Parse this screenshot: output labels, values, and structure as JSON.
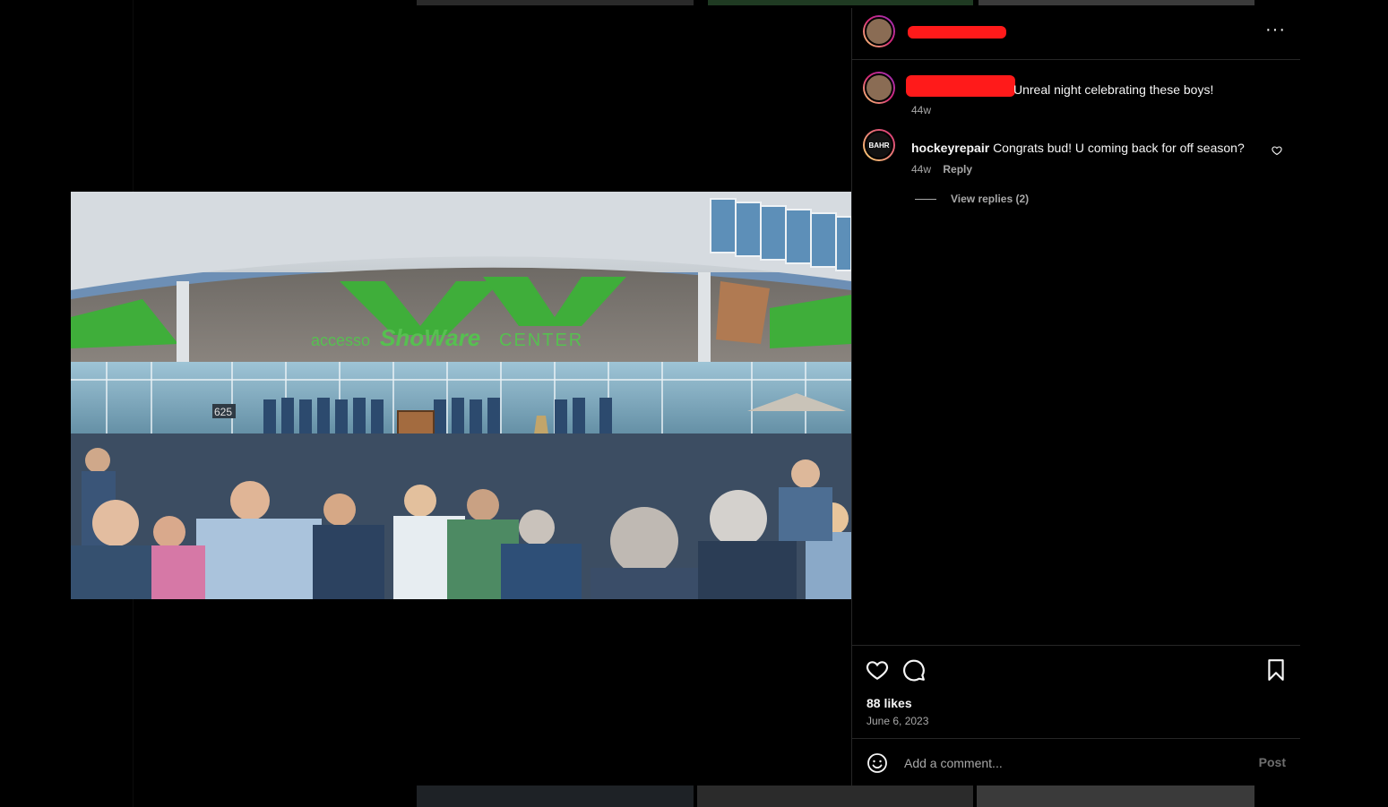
{
  "post": {
    "media": {
      "signage": {
        "brand": "accesso",
        "name": "ShoWare",
        "suffix": "CENTER",
        "number": "625"
      },
      "alt_icon": "photo-of-crowd-at-arena-stage"
    },
    "header": {
      "more_label": "···"
    },
    "caption": {
      "text": "Unreal night celebrating these boys!",
      "time": "44w"
    },
    "comments": [
      {
        "username": "hockeyrepair",
        "text": "Congrats bud! U coming back for off season?",
        "time": "44w",
        "reply_label": "Reply",
        "avatar_text": "BAHR"
      }
    ],
    "view_replies_label": "View replies (2)",
    "likes": "88 likes",
    "date": "June 6, 2023",
    "add_comment": {
      "placeholder": "Add a comment...",
      "post_label": "Post"
    }
  },
  "colors": {
    "background": "#000000",
    "divider": "#262626",
    "secondary_text": "#a8a8a8",
    "redaction": "#ff1a1a"
  }
}
